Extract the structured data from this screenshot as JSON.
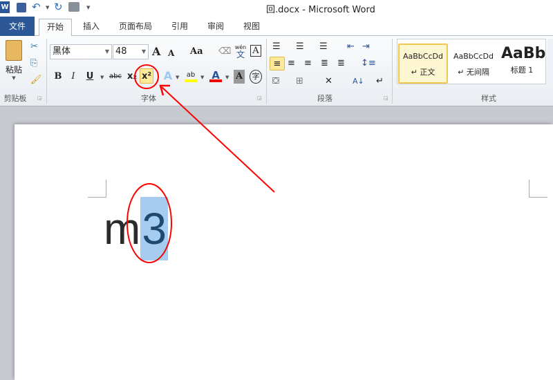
{
  "title": "回.docx - Microsoft Word",
  "tabs": {
    "file": "文件",
    "home": "开始",
    "insert": "插入",
    "layout": "页面布局",
    "references": "引用",
    "review": "审阅",
    "view": "视图"
  },
  "clipboard": {
    "paste": "粘贴",
    "label": "剪贴板"
  },
  "font": {
    "name": "黑体",
    "size": "48",
    "label": "字体",
    "grow": "A",
    "shrink": "A",
    "case": "Aa",
    "wen": "wén",
    "wen_char": "文",
    "border_a": "A",
    "bold": "B",
    "italic": "I",
    "underline": "U",
    "strike": "abc",
    "sub": "x₂",
    "sup": "x²",
    "effects": "A",
    "highlight": "ab",
    "color": "A",
    "shade": "A",
    "enclose": "字"
  },
  "paragraph": {
    "label": "段落"
  },
  "styles": {
    "label": "样式",
    "items": [
      {
        "preview": "AaBbCcDd",
        "name": "↵ 正文"
      },
      {
        "preview": "AaBbCcDd",
        "name": "↵ 无间隔"
      },
      {
        "preview": "AaBb",
        "name": "标题 1"
      }
    ]
  },
  "document": {
    "text_main": "m",
    "text_selected": "3"
  },
  "colors": {
    "accent": "#2a5699",
    "selected": "#a6cdef",
    "annotation": "#ff0000"
  }
}
